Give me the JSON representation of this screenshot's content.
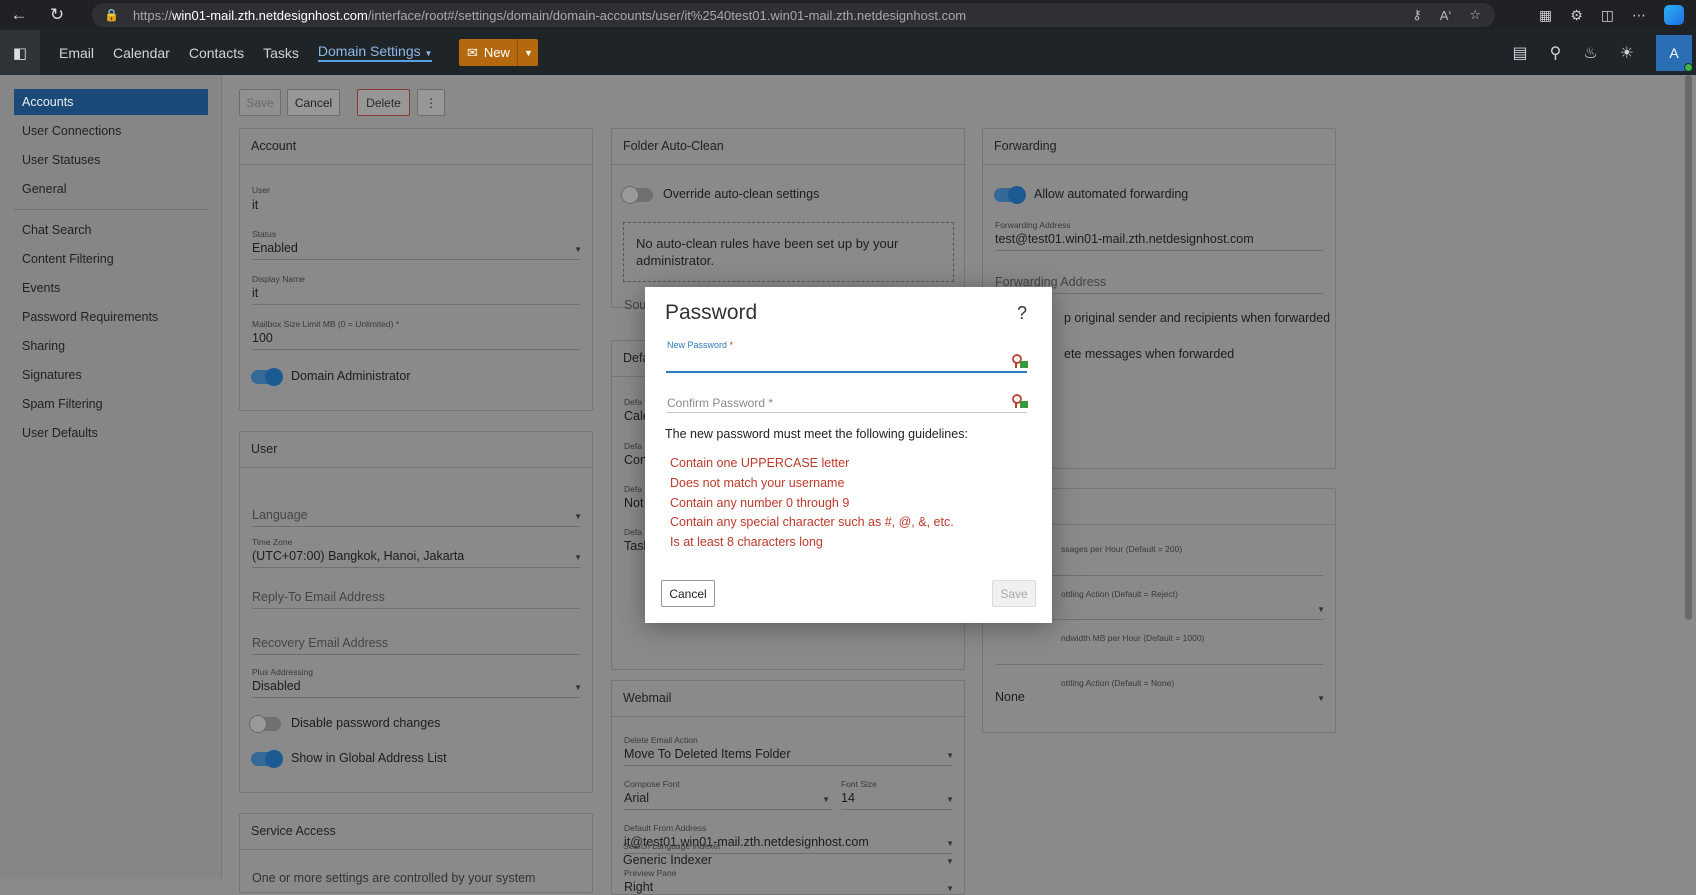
{
  "browser": {
    "url_prefix": "https://",
    "url_host": "win01-mail.zth.netdesignhost.com",
    "url_path": "/interface/root#/settings/domain/domain-accounts/user/it%2540test01.win01-mail.zth.netdesignhost.com"
  },
  "appbar": {
    "nav": [
      "Email",
      "Calendar",
      "Contacts",
      "Tasks"
    ],
    "domain_settings": "Domain Settings",
    "new_label": "New",
    "avatar_letter": "A"
  },
  "sidebar": {
    "items": [
      "Accounts",
      "User Connections",
      "User Statuses",
      "General",
      "Chat Search",
      "Content Filtering",
      "Events",
      "Password Requirements",
      "Sharing",
      "Signatures",
      "Spam Filtering",
      "User Defaults"
    ]
  },
  "toolbar": {
    "save": "Save",
    "cancel": "Cancel",
    "delete": "Delete",
    "more": "⋮"
  },
  "account": {
    "header": "Account",
    "user_label": "User",
    "user_value": "it",
    "status_label": "Status",
    "status_value": "Enabled",
    "display_label": "Display Name",
    "display_value": "it",
    "mailbox_label": "Mailbox Size Limit MB (0 = Unlimited) *",
    "mailbox_value": "100",
    "domain_admin": "Domain Administrator"
  },
  "user": {
    "header": "User",
    "language_ph": "Language",
    "tz_label": "Time Zone",
    "tz_value": "(UTC+07:00) Bangkok, Hanoi, Jakarta",
    "reply_ph": "Reply-To Email Address",
    "recovery_ph": "Recovery Email Address",
    "plus_label": "Plus Addressing",
    "plus_value": "Disabled",
    "disable_pw": "Disable password changes",
    "show_gal": "Show in Global Address List"
  },
  "service": {
    "header": "Service Access",
    "text": "One or more settings are controlled by your system"
  },
  "folder": {
    "header": "Folder Auto-Clean",
    "override": "Override auto-clean settings",
    "notice": "No auto-clean rules have been set up by your administrator.",
    "sou": "Sou"
  },
  "defaults": {
    "header_frag": "Defa",
    "rows": [
      {
        "label": "Defa",
        "value": "Cale"
      },
      {
        "label": "Defa",
        "value": "Con"
      },
      {
        "label": "Defa",
        "value": "Not"
      },
      {
        "label": "Defa",
        "value": "Task"
      }
    ]
  },
  "webmail": {
    "header_frag": "Webmail",
    "delete_label": "Delete Email Action",
    "delete_value": "Move To Deleted Items Folder",
    "font_label": "Compose Font",
    "font_value": "Arial",
    "size_label": "Font Size",
    "size_value": "14",
    "from_label": "Default From Address",
    "from_value": "it@test01.win01-mail.zth.netdesignhost.com",
    "preview_label": "Preview Pane",
    "preview_value": "Right",
    "indexer_label": "Search Language Indexer",
    "indexer_value": "Generic Indexer"
  },
  "forwarding": {
    "header": "Forwarding",
    "allow": "Allow automated forwarding",
    "fwd_label": "Forwarding Address",
    "fwd_value": "test@test01.win01-mail.zth.netdesignhost.com",
    "fwd2_ph": "Forwarding Address",
    "keep": "p original sender and recipients when forwarded",
    "delete": "ete messages when forwarded"
  },
  "throttle": {
    "msgs_label": "ssages per Hour (Default = 200)",
    "action_label": "ottling Action (Default = Reject)",
    "bw_label": "ndwidth MB per Hour (Default = 1000)",
    "bw_action_label": "ottling Action (Default = None)",
    "bw_action_value": "None"
  },
  "modal": {
    "title": "Password",
    "help": "?",
    "new_label": "New Password",
    "req": "*",
    "confirm_ph": "Confirm Password *",
    "guidelines": "The new password must meet the following guidelines:",
    "rules": [
      "Contain one UPPERCASE letter",
      "Does not match your username",
      "Contain any number 0 through 9",
      "Contain any special character such as #, @, &, etc.",
      "Is at least 8 characters long"
    ],
    "cancel": "Cancel",
    "save": "Save"
  }
}
